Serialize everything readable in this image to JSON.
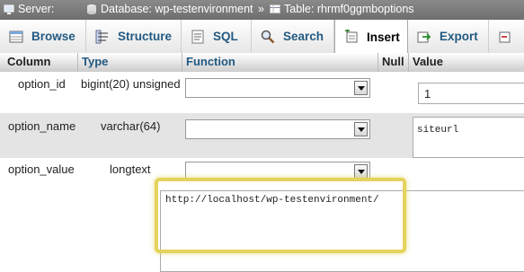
{
  "breadcrumb": {
    "server": "Server:",
    "database": "Database: wp-testenvironment",
    "separator": "»",
    "table": "Table: rhrmf0ggmboptions"
  },
  "tabs": [
    {
      "label": "Browse",
      "icon": "browse-icon"
    },
    {
      "label": "Structure",
      "icon": "structure-icon"
    },
    {
      "label": "SQL",
      "icon": "sql-icon"
    },
    {
      "label": "Search",
      "icon": "search-icon"
    },
    {
      "label": "Insert",
      "icon": "insert-icon",
      "active": true
    },
    {
      "label": "Export",
      "icon": "export-icon"
    }
  ],
  "columns": {
    "column": "Column",
    "type": "Type",
    "function": "Function",
    "null": "Null",
    "value": "Value"
  },
  "rows": [
    {
      "column": "option_id",
      "type": "bigint(20) unsigned",
      "function": "",
      "value": "1"
    },
    {
      "column": "option_name",
      "type": "varchar(64)",
      "function": "",
      "value": "siteurl"
    },
    {
      "column": "option_value",
      "type": "longtext",
      "function": "",
      "value": "http://localhost/wp-testenvironment/"
    }
  ],
  "colors": {
    "tab_text": "#235a81",
    "highlight": "#e4d35d",
    "row_alt": "#e4e4e4"
  }
}
